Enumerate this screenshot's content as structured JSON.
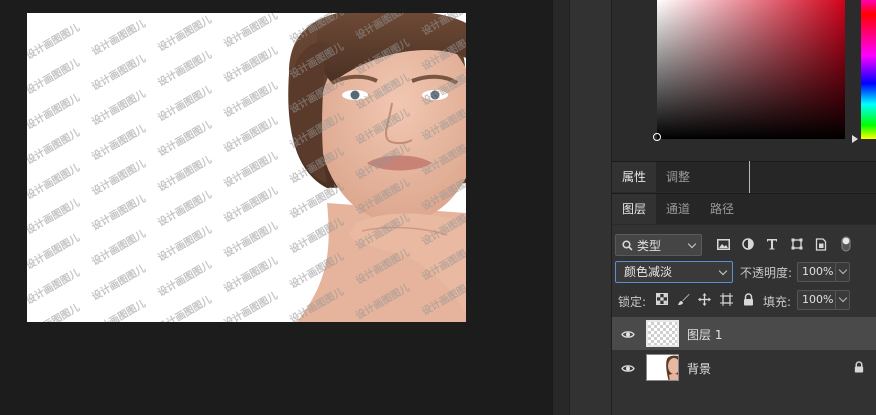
{
  "canvas": {
    "watermark_text": "设计画图图儿"
  },
  "panels": {
    "properties_tabs": [
      "属性",
      "调整"
    ],
    "layers_tabs": [
      "图层",
      "通道",
      "路径"
    ]
  },
  "layers_panel": {
    "filter_type_label": "类型",
    "blend_mode": "颜色减淡",
    "opacity_label": "不透明度:",
    "opacity_value": "100%",
    "lock_label": "锁定:",
    "fill_label": "填充:",
    "fill_value": "100%",
    "layers": [
      {
        "name": "图层 1",
        "selected": true,
        "visible": true,
        "locked": false
      },
      {
        "name": "背景",
        "selected": false,
        "visible": true,
        "locked": true
      }
    ]
  },
  "colors": {
    "accent_border": "#5c8ed8",
    "color_picker_hue": "#d0021b"
  },
  "icons": {
    "filter": [
      "search-icon",
      "image-filter-icon",
      "adjustment-filter-icon",
      "type-filter-icon",
      "shape-filter-icon",
      "smart-object-filter-icon",
      "filter-toggle-icon"
    ],
    "lock": [
      "lock-transparent-pixels-icon",
      "lock-image-pixels-icon",
      "lock-position-icon",
      "lock-artboard-icon",
      "lock-all-icon"
    ],
    "layer": [
      "eye-icon",
      "lock-icon"
    ]
  }
}
